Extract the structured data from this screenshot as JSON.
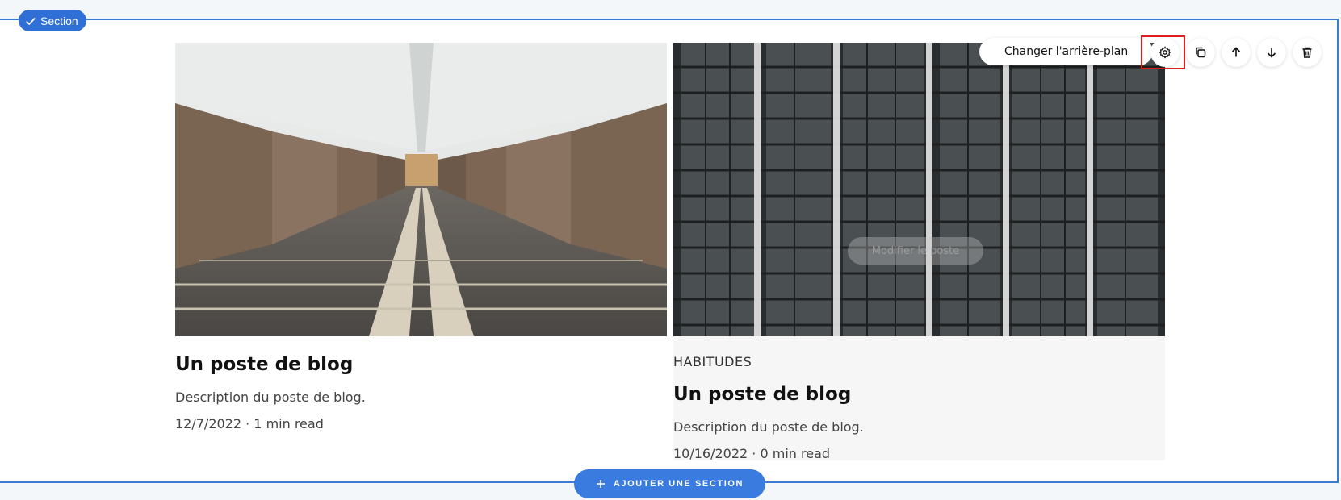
{
  "section_badge": {
    "label": "Section"
  },
  "toolbar": {
    "background_button": "Changer l'arrière-plan",
    "icons": [
      "gear-icon",
      "duplicate-icon",
      "arrow-up-icon",
      "arrow-down-icon",
      "trash-icon"
    ]
  },
  "posts": [
    {
      "category": "",
      "title": "Un poste de blog",
      "description": "Description du poste de blog.",
      "meta": "12/7/2022 · 1 min read"
    },
    {
      "category": "HABITUDES",
      "title": "Un poste de blog",
      "description": "Description du poste de blog.",
      "meta": "10/16/2022 · 0 min read",
      "hover_action": "Modifier le poste"
    }
  ],
  "add_section": {
    "label": "AJOUTER UNE SECTION"
  },
  "colors": {
    "accent": "#3a7be0",
    "highlight": "#e01c1c"
  }
}
